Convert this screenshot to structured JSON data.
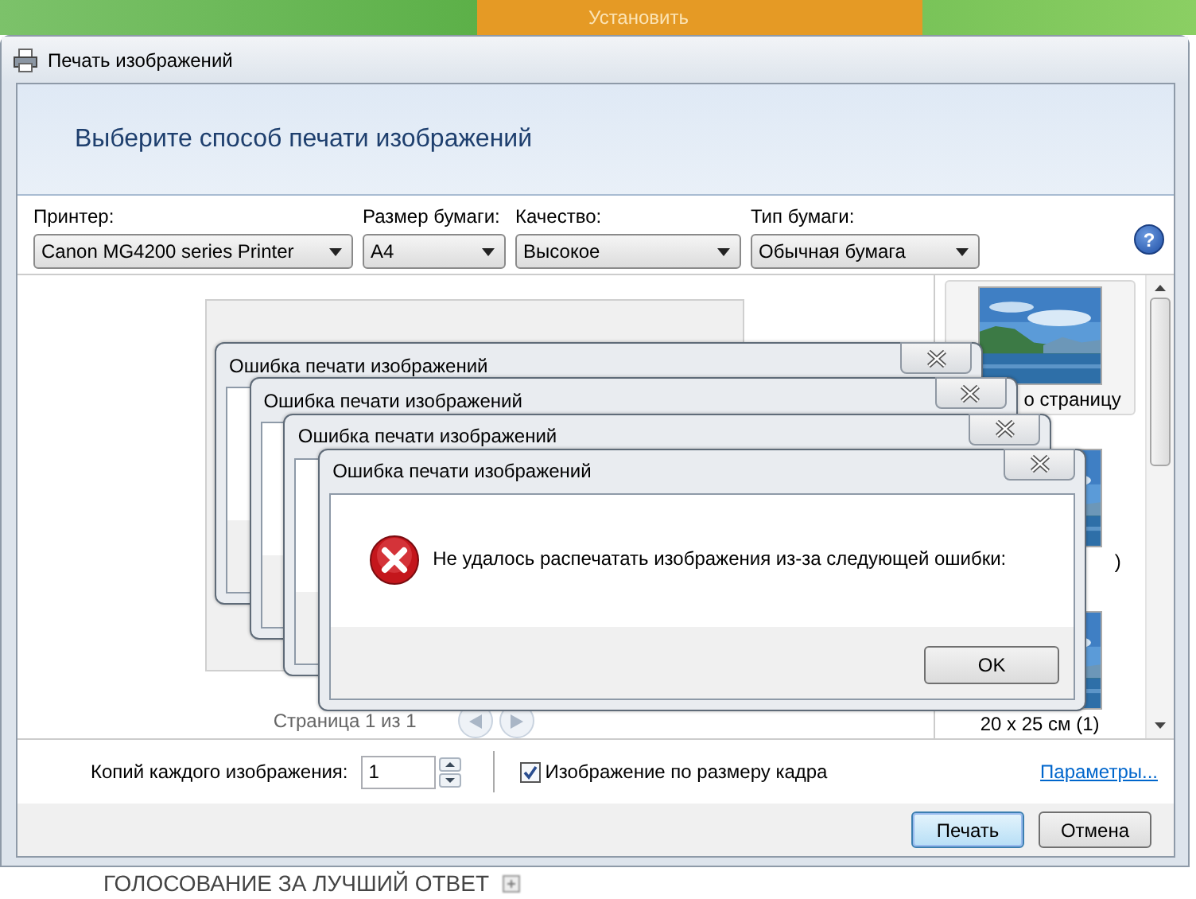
{
  "background": {
    "tab_label": "Установить",
    "bottom_heading": "ГОЛОСОВАНИЕ ЗА ЛУЧШИЙ ОТВЕТ"
  },
  "window": {
    "title": "Печать изображений"
  },
  "header": {
    "title": "Выберите способ печати изображений"
  },
  "options": [
    {
      "label": "Принтер:",
      "value": "Canon MG4200 series Printer"
    },
    {
      "label": "Размер бумаги:",
      "value": "A4"
    },
    {
      "label": "Качество:",
      "value": "Высокое"
    },
    {
      "label": "Тип бумаги:",
      "value": "Обычная бумага"
    }
  ],
  "help": "?",
  "preview": {
    "page_indicator": "Страница 1 из 1"
  },
  "layouts": [
    {
      "label": "о страницу",
      "selected": true
    },
    {
      "label": ")",
      "selected": false
    },
    {
      "label": "20 x 25 см (1)",
      "selected": false
    }
  ],
  "error_dialogs": [
    {
      "title": "Ошибка печати изображений"
    },
    {
      "title": "Ошибка печати изображений"
    },
    {
      "title": "Ошибка печати изображений"
    },
    {
      "title": "Ошибка печати изображений",
      "message": "Не удалось распечатать изображения из-за следующей ошибки:",
      "button": "OK"
    }
  ],
  "copies": {
    "label": "Копий каждого изображения:",
    "value": "1"
  },
  "fit": {
    "label": "Изображение по размеру кадра",
    "checked": true
  },
  "params_link": "Параметры...",
  "buttons": [
    {
      "label": "Печать",
      "default": true
    },
    {
      "label": "Отмена",
      "default": false
    }
  ]
}
